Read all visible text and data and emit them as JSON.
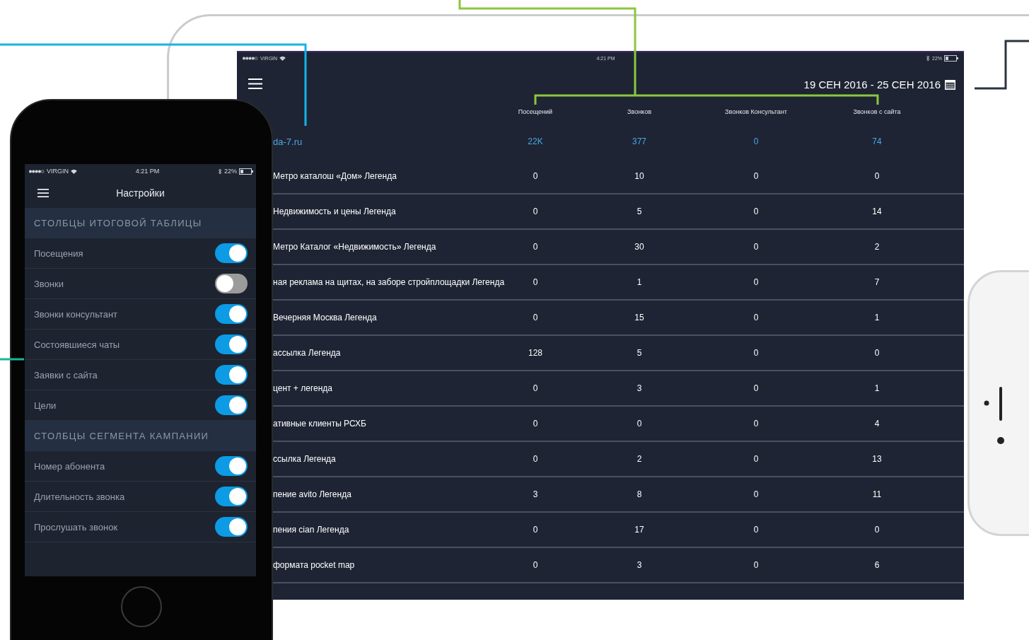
{
  "tablet": {
    "status_bar": {
      "carrier": "VIRGIN",
      "time": "4:21 PM",
      "battery": "22%"
    },
    "date_range": "19 СЕН 2016 - 25 СЕН 2016",
    "columns": [
      "Посещений",
      "Звонков",
      "Звонков Консультант",
      "Звонков с сайта"
    ],
    "summary": {
      "name": "da-7.ru",
      "values": [
        "22K",
        "377",
        "0",
        "74"
      ]
    },
    "rows": [
      {
        "name": "Метро каталош «Дом» Легенда",
        "values": [
          "0",
          "10",
          "0",
          "0"
        ]
      },
      {
        "name": "Недвижимость и цены Легенда",
        "values": [
          "0",
          "5",
          "0",
          "14"
        ]
      },
      {
        "name": "Метро Каталог «Недвижимость» Легенда",
        "values": [
          "0",
          "30",
          "0",
          "2"
        ]
      },
      {
        "name": "ная реклама на щитах, на заборе стройплощадки Легенда",
        "values": [
          "0",
          "1",
          "0",
          "7"
        ]
      },
      {
        "name": "Вечерняя Москва Легенда",
        "values": [
          "0",
          "15",
          "0",
          "1"
        ]
      },
      {
        "name": "ассылка Легенда",
        "values": [
          "128",
          "5",
          "0",
          "0"
        ]
      },
      {
        "name": "цент + легенда",
        "values": [
          "0",
          "3",
          "0",
          "1"
        ]
      },
      {
        "name": "ативные клиенты РСХБ",
        "values": [
          "0",
          "0",
          "0",
          "4"
        ]
      },
      {
        "name": "ссылка Легенда",
        "values": [
          "0",
          "2",
          "0",
          "13"
        ]
      },
      {
        "name": "пение avito Легенда",
        "values": [
          "3",
          "8",
          "0",
          "11"
        ]
      },
      {
        "name": "пения cian Легенда",
        "values": [
          "0",
          "17",
          "0",
          "0"
        ]
      },
      {
        "name": "формата pocket map",
        "values": [
          "0",
          "3",
          "0",
          "6"
        ]
      }
    ]
  },
  "phone": {
    "status_bar": {
      "carrier": "VIRGIN",
      "time": "4:21 PM",
      "battery": "22%"
    },
    "title": "Настройки",
    "sections": [
      {
        "title": "СТОЛБЦЫ ИТОГОВОЙ ТАБЛИЦЫ",
        "items": [
          {
            "label": "Посещения",
            "on": true
          },
          {
            "label": "Звонки",
            "on": false
          },
          {
            "label": "Звонки консультант",
            "on": true
          },
          {
            "label": "Состоявшиеся чаты",
            "on": true
          },
          {
            "label": "Заявки с сайта",
            "on": true
          },
          {
            "label": "Цели",
            "on": true
          }
        ]
      },
      {
        "title": "СТОЛБЦЫ СЕГМЕНТА КАМПАНИИ",
        "items": [
          {
            "label": "Номер абонента",
            "on": true
          },
          {
            "label": "Длительность звонка",
            "on": true
          },
          {
            "label": "Прослушать звонок",
            "on": true
          }
        ]
      }
    ]
  }
}
